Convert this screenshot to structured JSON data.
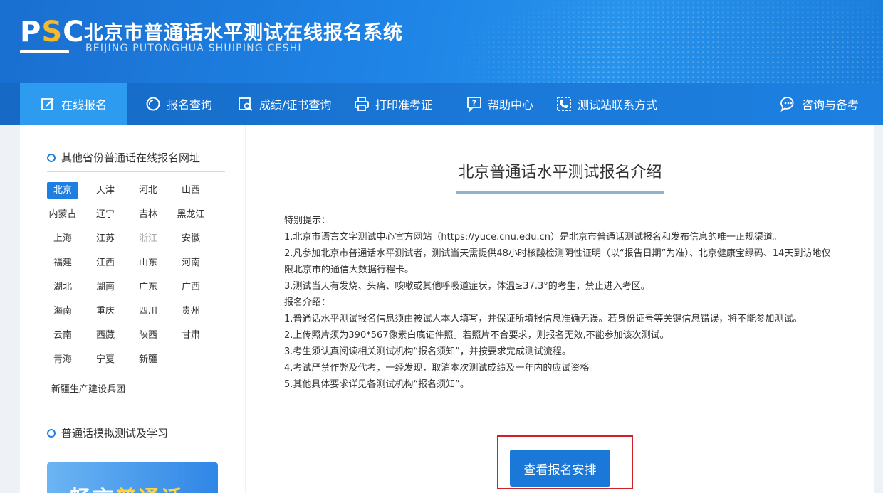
{
  "header": {
    "logo_text": "PSC",
    "title_cn": "北京市普通话水平测试在线报名系统",
    "title_en": "BEIJING PUTONGHUA SHUIPING CESHI"
  },
  "nav": {
    "items": [
      {
        "label": "在线报名",
        "icon": "edit-icon"
      },
      {
        "label": "报名查询",
        "icon": "search-circle-icon"
      },
      {
        "label": "成绩/证书查询",
        "icon": "certificate-search-icon"
      },
      {
        "label": "打印准考证",
        "icon": "printer-icon"
      },
      {
        "label": "帮助中心",
        "icon": "help-icon"
      },
      {
        "label": "测试站联系方式",
        "icon": "phone-icon"
      },
      {
        "label": "咨询与备考",
        "icon": "chat-icon"
      }
    ]
  },
  "sidebar": {
    "section1_title": "其他省份普通话在线报名网址",
    "provinces": [
      "北京",
      "天津",
      "河北",
      "山西",
      "内蒙古",
      "辽宁",
      "吉林",
      "黑龙江",
      "上海",
      "江苏",
      "浙江",
      "安徽",
      "福建",
      "江西",
      "山东",
      "河南",
      "湖北",
      "湖南",
      "广东",
      "广西",
      "海南",
      "重庆",
      "四川",
      "贵州",
      "云南",
      "西藏",
      "陕西",
      "甘肃",
      "青海",
      "宁夏",
      "新疆"
    ],
    "province_extra": "新疆生产建设兵团",
    "section2_title": "普通话模拟测试及学习",
    "promo_text_a": "畅言",
    "promo_text_b": "普通话"
  },
  "main": {
    "title": "北京普通话水平测试报名介绍",
    "lines": [
      "特别提示：",
      "1.北京市语言文字测试中心官方网站（https://yuce.cnu.edu.cn）是北京市普通话测试报名和发布信息的唯一正规渠道。",
      "2.凡参加北京市普通话水平测试者，测试当天需提供48小时核酸检测阴性证明（以“报告日期”为准）、北京健康宝绿码、14天到访地仅限北京市的通信大数据行程卡。",
      "3.测试当天有发烧、头痛、咳嗽或其他呼吸道症状，体温≥37.3°的考生，禁止进入考区。",
      "报名介绍：",
      "1.普通话水平测试报名信息须由被试人本人填写，并保证所填报信息准确无误。若身份证号等关键信息错误，将不能参加测试。",
      "2.上传照片须为390*567像素白底证件照。若照片不合要求，则报名无效,不能参加该次测试。",
      "3.考生须认真阅读相关测试机构“报名须知”，并按要求完成测试流程。",
      "4.考试严禁作弊及代考，一经发现，取消本次测试成绩及一年内的应试资格。",
      "5.其他具体要求详见各测试机构“报名须知”。"
    ],
    "button_label": "查看报名安排"
  },
  "colors": {
    "header_blue": "#1e84e6",
    "nav_active": "#2d9bf0",
    "accent": "#1f7fe0",
    "highlight_frame": "#d0202a"
  }
}
